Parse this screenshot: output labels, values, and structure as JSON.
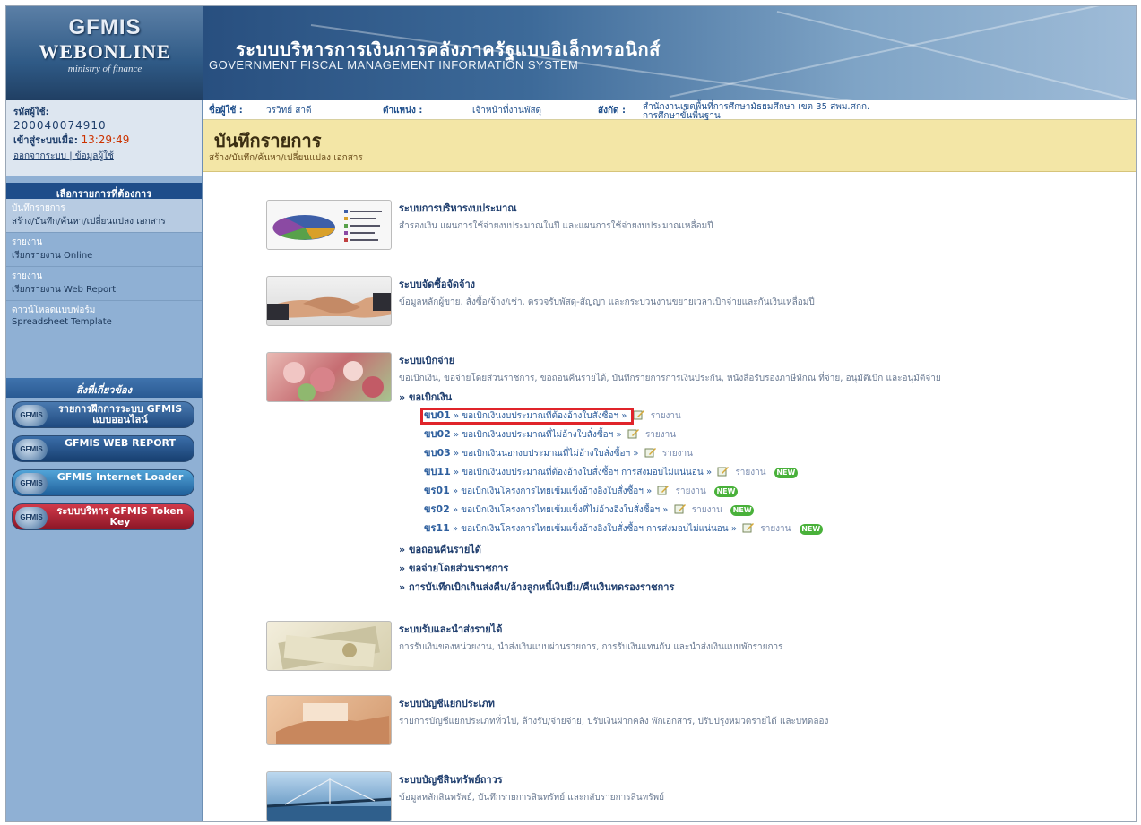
{
  "logo": {
    "line1": "GFMIS",
    "line2": "WEBONLINE",
    "line3": "ministry of finance"
  },
  "banner": {
    "thai_title": "ระบบบริหารการเงินการคลังภาครัฐแบบอิเล็กทรอนิกส์",
    "eng_title": "GOVERNMENT FISCAL MANAGEMENT INFORMATION SYSTEM"
  },
  "user": {
    "id_label": "รหัสผู้ใช้:",
    "id": "200040074910",
    "login_label": "เข้าสู่ระบบเมื่อ:",
    "login_time": "13:29:49",
    "links": "ออกจากระบบ | ข้อมูลผู้ใช้"
  },
  "infobar": {
    "user_label": "ชื่อผู้ใช้ :",
    "user_name": "วรวิทย์ สาดี",
    "position_label": "ตำแหน่ง :",
    "position": "เจ้าหน้าที่งานพัสดุ",
    "org_label": "สังกัด :",
    "org_line1": "สำนักงานเขตพื้นที่การศึกษามัธยมศึกษา เขต 35 สพม.ศกก.",
    "org_line2": "การศึกษาขั้นพื้นฐาน"
  },
  "page": {
    "title": "บันทึกรายการ",
    "subtitle": "สร้าง/บันทึก/ค้นหา/เปลี่ยนแปลง เอกสาร"
  },
  "sidebar": {
    "menu_header": "เลือกรายการที่ต้องการ",
    "groups": [
      {
        "category": "บันทึกรายการ",
        "item": "สร้าง/บันทึก/ค้นหา/เปลี่ยนแปลง เอกสาร"
      },
      {
        "category": "รายงาน",
        "item": "เรียกรายงาน Online"
      },
      {
        "category": "รายงาน",
        "item": "เรียกรายงาน Web Report"
      },
      {
        "category": "ดาวน์โหลดแบบฟอร์ม",
        "item": "Spreadsheet Template"
      }
    ],
    "related_header": "สิ่งที่เกี่ยวข้อง",
    "related": [
      {
        "badge": "GFMIS",
        "text": "รายการฝึกการระบบ GFMIS แบบออนไลน์"
      },
      {
        "badge": "GFMIS",
        "text": "GFMIS WEB REPORT"
      },
      {
        "badge": "GFMIS",
        "text": "GFMIS Internet Loader"
      },
      {
        "badge": "GFMIS",
        "text": "ระบบบริหาร GFMIS Token Key"
      }
    ]
  },
  "systems": [
    {
      "name": "ระบบการบริหารงบประมาณ",
      "desc": "สำรองเงิน แผนการใช้จ่ายงบประมาณในปี และแผนการใช้จ่ายงบประมาณเหลื่อมปี"
    },
    {
      "name": "ระบบจัดซื้อจัดจ้าง",
      "desc": "ข้อมูลหลักผู้ขาย, สั่งซื้อ/จ้าง/เช่า, ตรวจรับพัสดุ-สัญญา และกระบวนงานขยายเวลาเบิกจ่ายและกันเงินเหลื่อมปี"
    },
    {
      "name": "ระบบเบิกจ่าย",
      "desc": "ขอเบิกเงิน, ขอจ่ายโดยส่วนราชการ, ขอถอนคืนรายได้, บันทึกรายการการเงินประกัน, หนังสือรับรองภาษีหักณ ที่จ่าย, อนุมัติเบิก และอนุมัติจ่าย"
    },
    {
      "name": "ระบบรับและนำส่งรายได้",
      "desc": "การรับเงินของหน่วยงาน, นำส่งเงินแบบผ่านรายการ, การรับเงินแทนกัน และนำส่งเงินแบบพักรายการ"
    },
    {
      "name": "ระบบบัญชีแยกประเภท",
      "desc": "รายการบัญชีแยกประเภททั่วไป, ล้างรับ/จ่ายจ่าย, ปรับเงินฝากคลัง พักเอกสาร, ปรับปรุงหมวดรายได้ และบทดลอง"
    },
    {
      "name": "ระบบบัญชีสินทรัพย์ถาวร",
      "desc": "ข้อมูลหลักสินทรัพย์, บันทึกรายการสินทรัพย์ และกลับรายการสินทรัพย์"
    }
  ],
  "disbursement": {
    "group_withdraw": "ขอเบิกเงิน",
    "forms": [
      {
        "code": "ขบ01",
        "label": "ขอเบิกเงินงบประมาณที่ต้องอ้างใบสั่งซื้อฯ",
        "report": "รายงาน",
        "new": ""
      },
      {
        "code": "ขบ02",
        "label": "ขอเบิกเงินงบประมาณที่ไม่อ้างใบสั่งซื้อฯ",
        "report": "รายงาน",
        "new": ""
      },
      {
        "code": "ขบ03",
        "label": "ขอเบิกเงินนอกงบประมาณที่ไม่อ้างใบสั่งซื้อฯ",
        "report": "รายงาน",
        "new": ""
      },
      {
        "code": "ขบ11",
        "label": "ขอเบิกเงินงบประมาณที่ต้องอ้างใบสั่งซื้อฯ การส่งมอบไม่แน่นอน",
        "report": "รายงาน",
        "new": "NEW"
      },
      {
        "code": "ขร01",
        "label": "ขอเบิกเงินโครงการไทยเข้มแข็งอ้างอิงใบสั่งซื้อฯ",
        "report": "รายงาน",
        "new": "NEW"
      },
      {
        "code": "ขร02",
        "label": "ขอเบิกเงินโครงการไทยเข้มแข็งที่ไม่อ้างอิงใบสั่งซื้อฯ",
        "report": "รายงาน",
        "new": "NEW"
      },
      {
        "code": "ขร11",
        "label": "ขอเบิกเงินโครงการไทยเข้มแข็งอ้างอิงใบสั่งซื้อฯ การส่งมอบไม่แน่นอน",
        "report": "รายงาน",
        "new": "NEW"
      }
    ],
    "group_refund": "ขอถอนคืนรายได้",
    "group_pay": "ขอจ่ายโดยส่วนราชการ",
    "group_record": "การบันทึกเบิกเกินส่งคืน/ล้างลูกหนี้เงินยืม/คืนเงินทดรองราชการ"
  },
  "colors": {
    "highlight": "#e0242a",
    "title_bg": "#f3e6a6",
    "sidebar_bg": "#8fb0d4",
    "new_badge": "#49b13a"
  }
}
